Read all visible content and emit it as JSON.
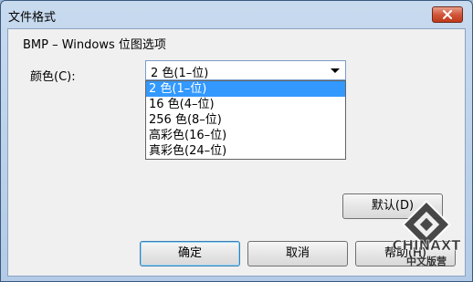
{
  "window": {
    "title": "文件格式"
  },
  "group": {
    "title": "BMP – Windows 位图选项"
  },
  "color": {
    "label": "颜色(C):",
    "selected": "2 色(1–位)",
    "options": [
      "2 色(1–位)",
      "16 色(4–位)",
      "256 色(8–位)",
      "高彩色(16–位)",
      "真彩色(24–位)"
    ]
  },
  "buttons": {
    "default_reset": "默认(D)",
    "ok": "确定",
    "cancel": "取消",
    "help": "帮助(H)"
  },
  "watermark": {
    "text": "CHINAXT",
    "subtext": "中文版营"
  },
  "colors": {
    "selection": "#3399ff",
    "close_button": "#c0391a",
    "title_bar": "#b3cbe6"
  }
}
